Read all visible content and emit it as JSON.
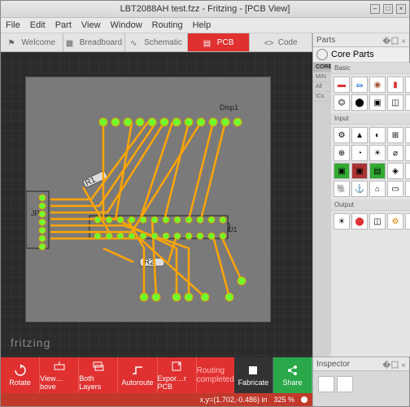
{
  "window": {
    "title": "LBT2088AH test.fzz - Fritzing - [PCB View]"
  },
  "menu": [
    "File",
    "Edit",
    "Part",
    "View",
    "Window",
    "Routing",
    "Help"
  ],
  "tabs": [
    {
      "label": "Welcome"
    },
    {
      "label": "Breadboard"
    },
    {
      "label": "Schematic"
    },
    {
      "label": "PCB"
    },
    {
      "label": "Code"
    }
  ],
  "brand": "fritzing",
  "pcb_labels": {
    "disp": "Disp1",
    "jp": "JP1",
    "u": "U1",
    "r1": "R1",
    "r2": "R2"
  },
  "toolbar": {
    "rotate": "Rotate",
    "viewabove": "View…bove",
    "bothlayers": "Both Layers",
    "autoroute": "Autoroute",
    "export": "Expor…r PCB",
    "status": "Routing completed",
    "fabricate": "Fabricate",
    "share": "Share"
  },
  "status": {
    "coords": "x,y=(1.702,-0.486) in",
    "zoom": "325 %"
  },
  "parts": {
    "title": "Parts",
    "picker": "Core Parts",
    "cats": [
      "CORE",
      "MIN",
      "All",
      "ICs"
    ],
    "sections": {
      "basic": "Basic",
      "input": "Input",
      "output": "Output"
    }
  },
  "inspector": {
    "title": "Inspector"
  }
}
